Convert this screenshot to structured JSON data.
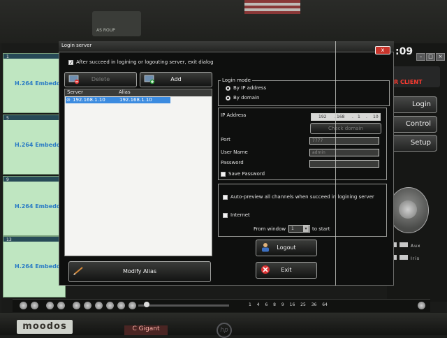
{
  "app": {
    "clock": ":09",
    "brand": "R CLIENT",
    "top_logo": "AS ROUP",
    "side_buttons": [
      "Login",
      "Control",
      "Setup"
    ],
    "ptz_rows": [
      "Aux",
      "Iris"
    ],
    "layout_numbers": "1 4 6 8 9 16 25 36 64"
  },
  "video_panels": [
    {
      "num": "1",
      "label": "H.264 Embedd"
    },
    {
      "num": "5",
      "label": "H.264 Embedd"
    },
    {
      "num": "9",
      "label": "H.264 Embedd"
    },
    {
      "num": "13",
      "label": "H.264 Embedd"
    }
  ],
  "dialog": {
    "title": "Login server",
    "close_label": "x",
    "auto_exit_label": "After succeed in logining or logouting server, exit dialog",
    "auto_exit_checked": true,
    "delete_label": "Delete",
    "add_label": "Add",
    "table": {
      "col_server": "Server",
      "col_alias": "Alias",
      "rows": [
        {
          "server": "192.168.1.10",
          "alias": "192.168.1.10"
        }
      ]
    },
    "modify_alias_label": "Modify Alias",
    "login_mode": {
      "title": "Login mode",
      "by_ip_label": "By IP address",
      "by_domain_label": "By domain",
      "selected": "By IP address"
    },
    "form": {
      "ip_label": "IP Address",
      "ip_parts": [
        "192",
        "168",
        "1",
        "10"
      ],
      "check_domain_label": "Check domain",
      "port_label": "Port",
      "port_value": "7777",
      "user_label": "User Name",
      "user_value": "admin",
      "password_label": "Password",
      "password_value": "",
      "save_password_label": "Save Password"
    },
    "preview": {
      "auto_preview_label": "Auto-preview all channels when succeed in logining server",
      "internet_label": "Internet",
      "from_window_label": "From window",
      "from_window_value": "1",
      "to_start_label": "to start"
    },
    "logout_label": "Logout",
    "exit_label": "Exit"
  },
  "desk": {
    "sticker": "moodos",
    "card": "C Gigant",
    "hp": "hp"
  },
  "colors": {
    "selection": "#3b8be0",
    "video_bg": "#bfe6c1",
    "video_label": "#2a7bc4",
    "brand_red": "#ff3b30"
  }
}
